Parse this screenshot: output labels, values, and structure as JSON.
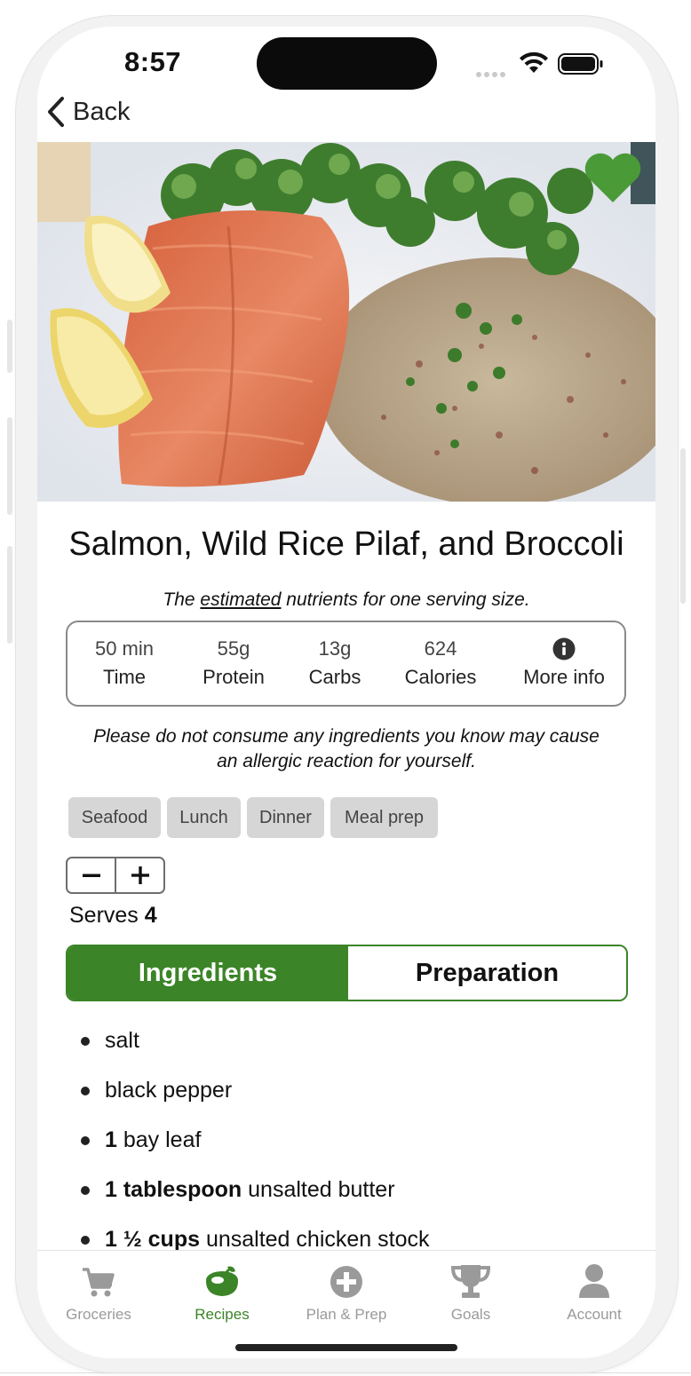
{
  "status_bar": {
    "time": "8:57"
  },
  "nav": {
    "back_label": "Back"
  },
  "recipe": {
    "title": "Salmon, Wild Rice Pilaf, and Broccoli",
    "favorite": true,
    "note_prefix": "The ",
    "note_emphasis": "estimated",
    "note_suffix": " nutrients for one serving size.",
    "stats": [
      {
        "value": "50 min",
        "label": "Time"
      },
      {
        "value": "55g",
        "label": "Protein"
      },
      {
        "value": "13g",
        "label": "Carbs"
      },
      {
        "value": "624",
        "label": "Calories"
      }
    ],
    "more_info_label": "More info",
    "allergy_note": "Please do not consume any ingredients you know may cause an allergic reaction for yourself.",
    "tags": [
      "Seafood",
      "Lunch",
      "Dinner",
      "Meal prep"
    ],
    "serves_label": "Serves",
    "serves_value": "4"
  },
  "tabs": {
    "ingredients": "Ingredients",
    "preparation": "Preparation",
    "active": "Ingredients"
  },
  "ingredients": [
    {
      "qty": "",
      "text": "salt"
    },
    {
      "qty": "",
      "text": "black pepper"
    },
    {
      "qty": "1",
      "text": " bay leaf"
    },
    {
      "qty": "1 tablespoon",
      "text": " unsalted butter"
    },
    {
      "qty": "1 ½ cups",
      "text": " unsalted chicken stock"
    }
  ],
  "tab_bar": {
    "items": [
      {
        "label": "Groceries",
        "icon": "cart-icon"
      },
      {
        "label": "Recipes",
        "icon": "recipes-icon"
      },
      {
        "label": "Plan & Prep",
        "icon": "plus-circle-icon"
      },
      {
        "label": "Goals",
        "icon": "trophy-icon"
      },
      {
        "label": "Account",
        "icon": "user-icon"
      }
    ],
    "active": "Recipes"
  },
  "colors": {
    "accent_green": "#3b8427",
    "heart_green": "#4a9a38",
    "tag_bg": "#d6d6d6",
    "inactive_tab": "#9a9a9a"
  }
}
